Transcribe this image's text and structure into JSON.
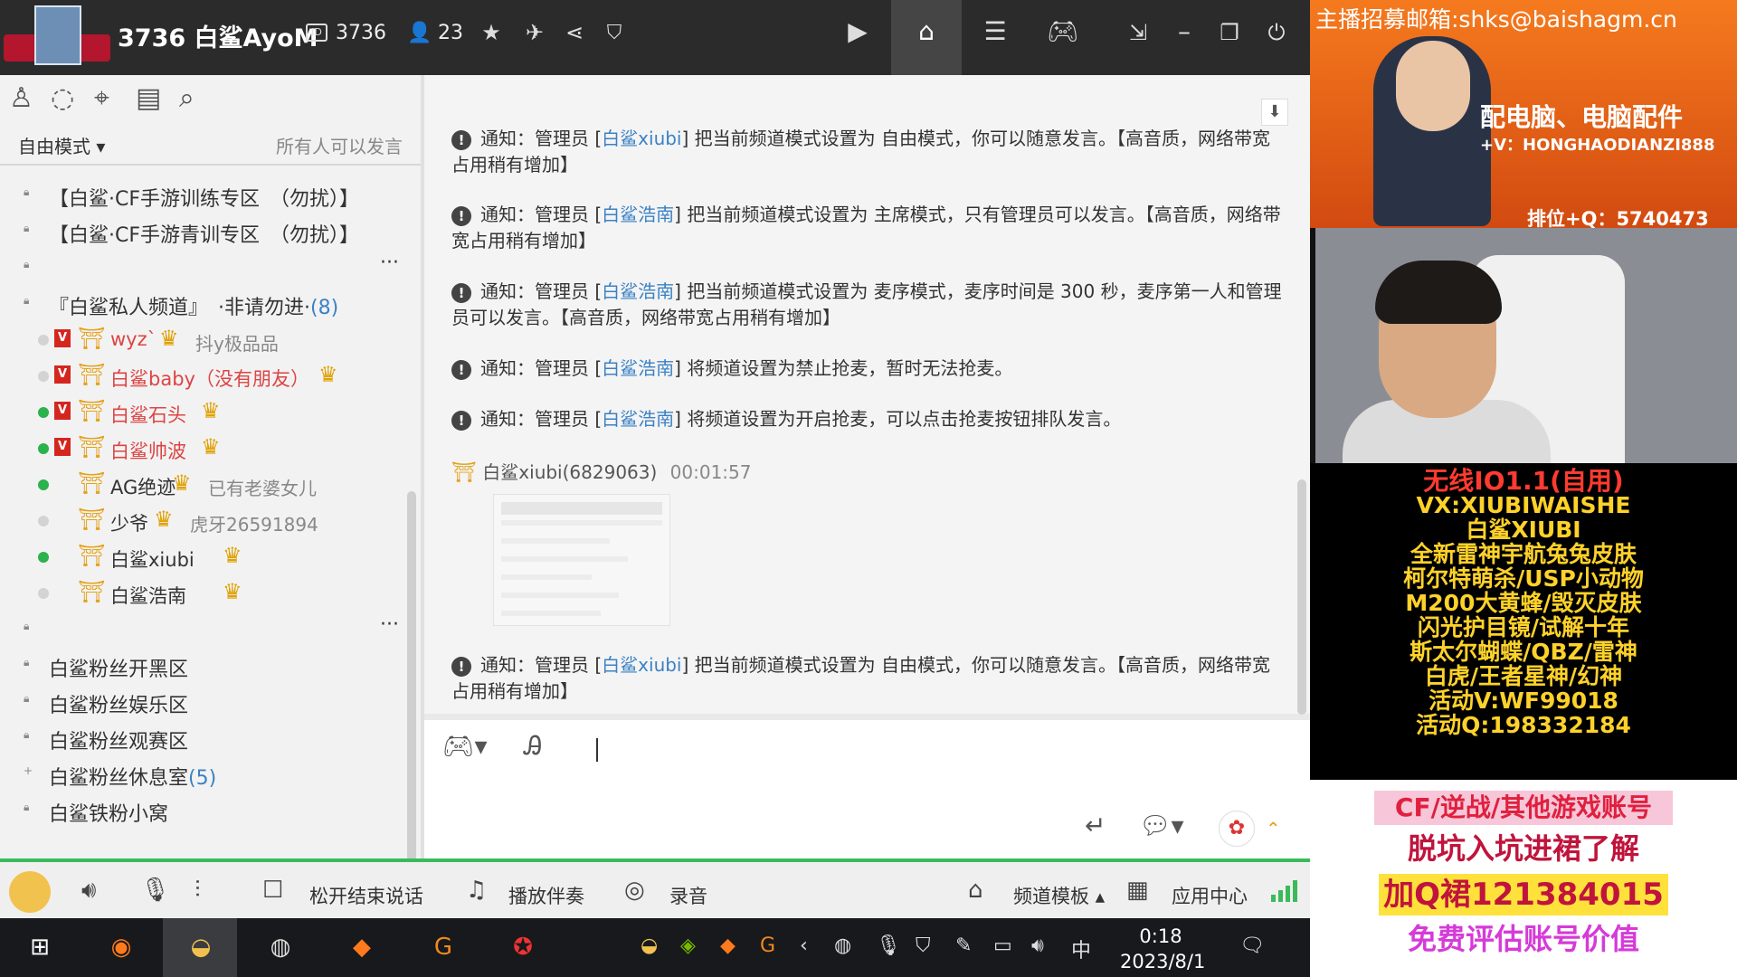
{
  "window": {
    "room_title": "3736 白鲨AyoM",
    "room_id": "3736",
    "online_count": "23"
  },
  "left": {
    "mode_label": "自由模式",
    "mode_hint": "所有人可以发言",
    "channels_top": [
      "【白鲨·CF手游训练专区　（勿扰）】",
      "【白鲨·CF手游青训专区　（勿扰）】"
    ],
    "private_channel": "『白鲨私人频道』　·非请勿进·",
    "private_count": "(8)",
    "members": [
      {
        "name": "wyz`",
        "sign": "抖y极品品",
        "status": "gray",
        "vip": true,
        "name_color": "#d44"
      },
      {
        "name": "白鲨baby（没有朋友）",
        "sign": "",
        "status": "gray",
        "vip": true,
        "name_color": "#d44"
      },
      {
        "name": "白鲨石头",
        "sign": "",
        "status": "green",
        "vip": true,
        "name_color": "#d44"
      },
      {
        "name": "白鲨帅波",
        "sign": "",
        "status": "green",
        "vip": true,
        "name_color": "#d44"
      },
      {
        "name": "AG绝迹",
        "sign": "已有老婆女儿",
        "status": "green",
        "vip": false,
        "name_color": "#333"
      },
      {
        "name": "少爷",
        "sign": "虎牙26591894",
        "status": "gray",
        "vip": false,
        "name_color": "#333"
      },
      {
        "name": "白鲨xiubi",
        "sign": "",
        "status": "green",
        "vip": false,
        "name_color": "#333"
      },
      {
        "name": "白鲨浩南",
        "sign": "",
        "status": "gray",
        "vip": false,
        "name_color": "#333"
      }
    ],
    "channels_bottom": [
      "白鲨粉丝开黑区",
      "白鲨粉丝娱乐区",
      "白鲨粉丝观赛区",
      "白鲨粉丝休息室",
      "白鲨铁粉小窝"
    ],
    "rest_count": "(5)"
  },
  "chat": {
    "notices": [
      {
        "prefix": "通知：管理员 [",
        "admin": "白鲨xiubi",
        "text": "] 把当前频道模式设置为 自由模式，你可以随意发言。【高音质，网络带宽占用稍有增加】"
      },
      {
        "prefix": "通知：管理员 [",
        "admin": "白鲨浩南",
        "text": "] 把当前频道模式设置为 主席模式，只有管理员可以发言。【高音质，网络带宽占用稍有增加】"
      },
      {
        "prefix": "通知：管理员 [",
        "admin": "白鲨浩南",
        "text": "] 把当前频道模式设置为 麦序模式，麦序时间是 300 秒，麦序第一人和管理员可以发言。【高音质，网络带宽占用稍有增加】"
      },
      {
        "prefix": "通知：管理员 [",
        "admin": "白鲨浩南",
        "text": "] 将频道设置为禁止抢麦，暂时无法抢麦。"
      },
      {
        "prefix": "通知：管理员 [",
        "admin": "白鲨浩南",
        "text": "] 将频道设置为开启抢麦，可以点击抢麦按钮排队发言。"
      },
      {
        "prefix": "通知：管理员 [",
        "admin": "白鲨xiubi",
        "text": "] 把当前频道模式设置为 自由模式，你可以随意发言。【高音质，网络带宽占用稍有增加】"
      }
    ],
    "message_sender": "白鲨xiubi(6829063)",
    "message_time": "00:01:57"
  },
  "bottom": {
    "release_label": "松开结束说话",
    "music_label": "播放伴奏",
    "record_label": "录音",
    "template_label": "频道模板",
    "apps_label": "应用中心"
  },
  "taskbar": {
    "time": "0:18",
    "date": "2023/8/1",
    "ime": "中"
  },
  "overlay": {
    "recruit_mail": "主播招募邮箱:shks@baishagm.cn",
    "ad1_line1": "配电脑、电脑配件",
    "ad1_line2": "+V：HONGHAODIANZI888",
    "ad1_line3": "排位+Q：5740473",
    "ad2_lines": [
      "无线IO1.1(自用)",
      "VX:XIUBIWAISHE",
      "白鲨XIUBI",
      "全新雷神宇航兔兔皮肤",
      "柯尔特萌杀/USP小动物",
      "M200大黄蜂/毁灭皮肤",
      "闪光护目镜/试解十年",
      "斯太尔蝴蝶/QBZ/雷神",
      "白虎/王者星神/幻神",
      "活动V:WF99018",
      "活动Q:198332184"
    ],
    "ad3_line1": "CF/逆战/其他游戏账号",
    "ad3_line2": "脱坑入坑进裙了解",
    "ad3_line3": "加Q裙121384015",
    "ad3_line4": "免费评估账号价值"
  }
}
